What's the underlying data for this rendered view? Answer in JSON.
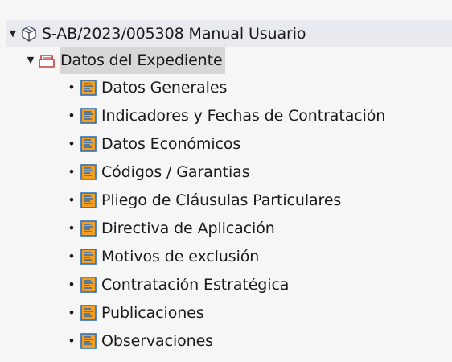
{
  "tree": {
    "root": {
      "label": "S-AB/2023/005308 Manual Usuario",
      "icon": "package-icon",
      "expanded": true
    },
    "parent": {
      "label": "Datos del Expediente",
      "icon": "folder-stack-icon",
      "expanded": true
    },
    "items": [
      {
        "label": "Datos Generales",
        "icon": "form-icon"
      },
      {
        "label": "Indicadores y Fechas de Contratación",
        "icon": "form-icon"
      },
      {
        "label": "Datos Económicos",
        "icon": "form-icon"
      },
      {
        "label": "Códigos / Garantias",
        "icon": "form-icon"
      },
      {
        "label": "Pliego de Cláusulas Particulares",
        "icon": "form-icon"
      },
      {
        "label": "Directiva de Aplicación",
        "icon": "form-icon"
      },
      {
        "label": "Motivos de exclusión",
        "icon": "form-icon"
      },
      {
        "label": "Contratación Estratégica",
        "icon": "form-icon"
      },
      {
        "label": "Publicaciones",
        "icon": "form-icon"
      },
      {
        "label": "Observaciones",
        "icon": "form-icon"
      }
    ],
    "bullet_glyph": "•",
    "twisty_glyph": "▼",
    "colors": {
      "form_icon_blue": "#2c6fb7",
      "form_icon_orange": "#f29e22",
      "folder_icon_red": "#c93a3a",
      "root_highlight": "#e8eaf0",
      "parent_highlight": "#d7d7d7"
    }
  }
}
